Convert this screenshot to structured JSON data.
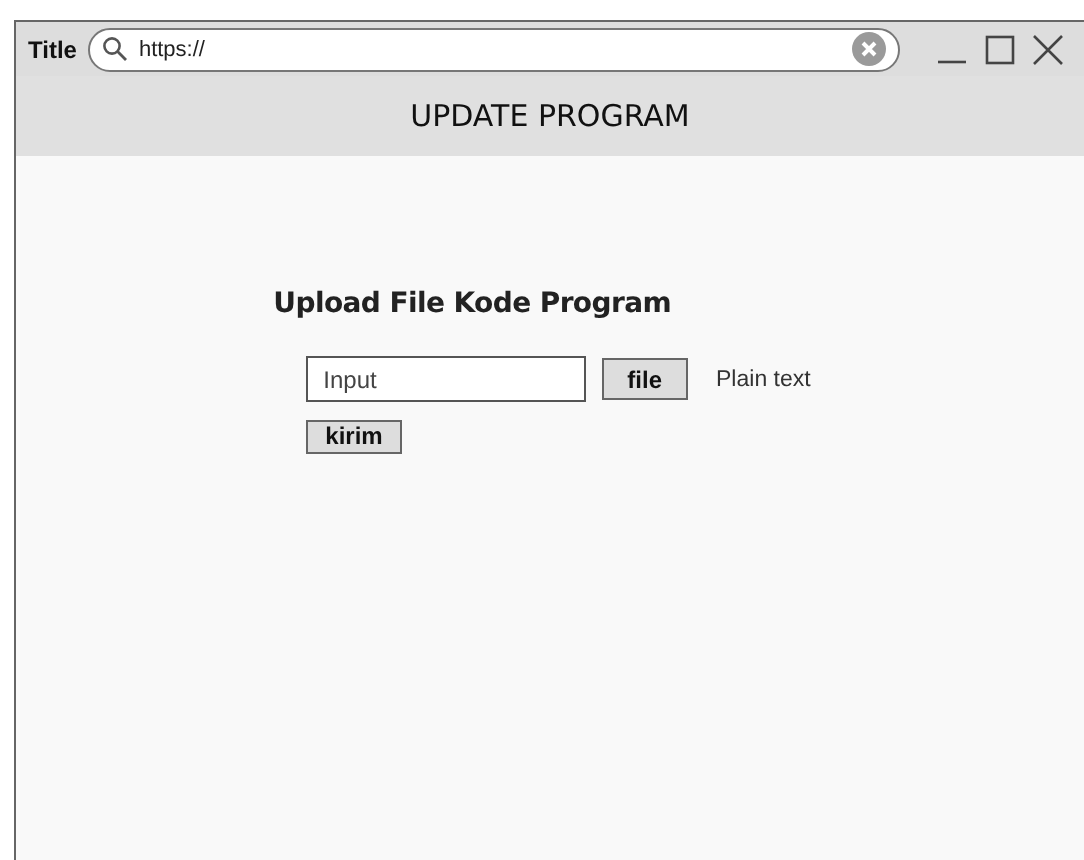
{
  "window": {
    "title": "Title",
    "address": "https://"
  },
  "header": {
    "title": "UPDATE PROGRAM"
  },
  "form": {
    "heading": "Upload File Kode Program",
    "input": {
      "placeholder": "Input"
    },
    "file_button": "file",
    "note": "Plain text",
    "submit_button": "kirim"
  }
}
